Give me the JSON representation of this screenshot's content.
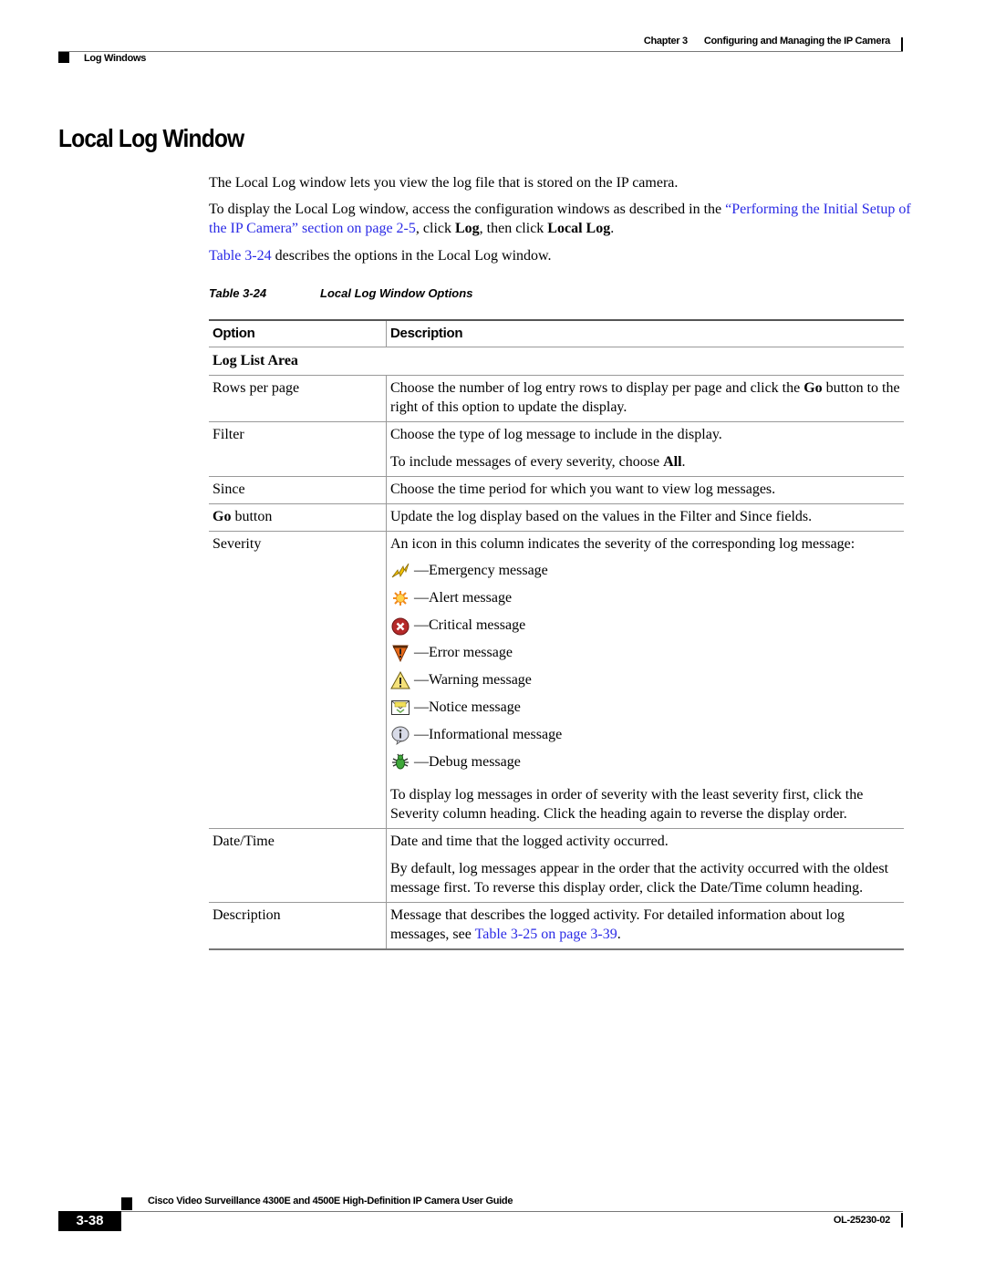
{
  "header": {
    "chapter_label": "Chapter 3",
    "chapter_title": "Configuring and Managing the IP Camera",
    "section": "Log Windows"
  },
  "title": "Local Log Window",
  "intro": {
    "p1": "The Local Log window lets you view the log file that is stored on the IP camera.",
    "p2_pre": "To display the Local Log window, access the configuration windows as described in the ",
    "p2_link": "“Performing the Initial Setup of the IP Camera” section on page 2-5",
    "p2_mid1": ", click ",
    "p2_bold1": "Log",
    "p2_mid2": ", then click ",
    "p2_bold2": "Local Log",
    "p2_end": ".",
    "p3_link": "Table 3-24",
    "p3_rest": " describes the options in the Local Log window."
  },
  "table": {
    "caption_number": "Table 3-24",
    "caption_title": "Local Log Window Options",
    "headers": [
      "Option",
      "Description"
    ],
    "section_label": "Log List Area",
    "rows": {
      "rows_per_page": {
        "option": "Rows per page",
        "desc_pre": "Choose the number of log entry rows to display per page and click the ",
        "desc_bold": "Go",
        "desc_post": " button to the right of this option to update the display."
      },
      "filter": {
        "option": "Filter",
        "desc1": "Choose the type of log message to include in the display.",
        "desc2_pre": "To include messages of every severity, choose ",
        "desc2_bold": "All",
        "desc2_post": "."
      },
      "since": {
        "option": "Since",
        "desc": "Choose the time period for which you want to view log messages."
      },
      "go_button": {
        "option_bold": "Go",
        "option_rest": " button",
        "desc": "Update the log display based on the values in the Filter and Since fields."
      },
      "severity": {
        "option": "Severity",
        "desc_intro": "An icon in this column indicates the severity of the corresponding log message:",
        "levels": [
          {
            "icon": "emergency-icon",
            "label": "—Emergency message"
          },
          {
            "icon": "alert-icon",
            "label": "—Alert message"
          },
          {
            "icon": "critical-icon",
            "label": "—Critical message"
          },
          {
            "icon": "error-icon",
            "label": "—Error message"
          },
          {
            "icon": "warning-icon",
            "label": "—Warning message"
          },
          {
            "icon": "notice-icon",
            "label": "—Notice message"
          },
          {
            "icon": "informational-icon",
            "label": "—Informational message"
          },
          {
            "icon": "debug-icon",
            "label": "—Debug message"
          }
        ],
        "desc_outro": "To display log messages in order of severity with the least severity first, click the Severity column heading. Click the heading again to reverse the display order."
      },
      "datetime": {
        "option": "Date/Time",
        "desc1": "Date and time that the logged activity occurred.",
        "desc2": "By default, log messages appear in the order that the activity occurred with the oldest message first. To reverse this display order, click the Date/Time column heading."
      },
      "description": {
        "option": "Description",
        "desc_pre": "Message that describes the logged activity. For detailed information about log messages, see ",
        "desc_link": "Table 3-25 on page 3-39",
        "desc_post": "."
      }
    }
  },
  "footer": {
    "guide_title": "Cisco Video Surveillance 4300E and 4500E High-Definition IP Camera User Guide",
    "page_number": "3-38",
    "doc_number": "OL-25230-02"
  },
  "colors": {
    "link": "#2a2ae6",
    "rule": "#999999"
  }
}
